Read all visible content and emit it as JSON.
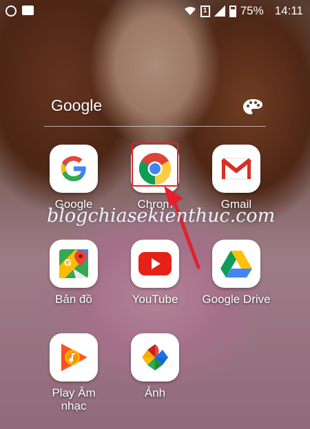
{
  "status_bar": {
    "battery_percent": "75%",
    "time": "14:11",
    "sim_label": "1"
  },
  "folder": {
    "title": "Google"
  },
  "apps": [
    {
      "label": "Google",
      "icon": "google-g-icon"
    },
    {
      "label": "Chrome",
      "icon": "chrome-icon"
    },
    {
      "label": "Gmail",
      "icon": "gmail-icon"
    },
    {
      "label": "Bản đồ",
      "icon": "maps-icon"
    },
    {
      "label": "YouTube",
      "icon": "youtube-icon"
    },
    {
      "label": "Google Drive",
      "icon": "drive-icon"
    },
    {
      "label": "Play Âm\nnhạc",
      "icon": "play-music-icon"
    },
    {
      "label": "Ảnh",
      "icon": "photos-icon"
    }
  ],
  "chrome_label_visible": "Chrom",
  "watermark": "blogchiasekienthuc.com",
  "colors": {
    "highlight": "#e3202b",
    "arrow": "#e3202b"
  }
}
